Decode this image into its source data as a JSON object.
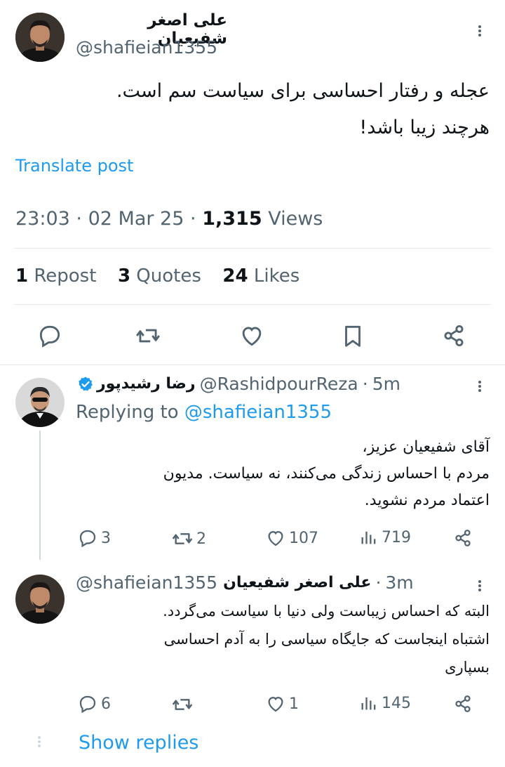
{
  "main_post": {
    "author_name": "علی اصغر شفیعیان",
    "handle": "@shafieian1355",
    "text_line1": "عجله و رفتار احساسی برای سیاست سم است.",
    "text_line2": "هرچند زیبا باشد!",
    "translate_label": "Translate post",
    "time": "23:03",
    "date": "02 Mar 25",
    "views_count": "1,315",
    "views_label": "Views",
    "separator": "·",
    "reposts_count": "1",
    "reposts_label": "Repost",
    "quotes_count": "3",
    "quotes_label": "Quotes",
    "likes_count": "24",
    "likes_label": "Likes",
    "icons": [
      "reply-icon",
      "repost-icon",
      "like-icon",
      "bookmark-icon",
      "share-icon"
    ]
  },
  "reply1": {
    "author_name": "رضا رشیدپور",
    "handle": "@RashidpourReza",
    "time": "5m",
    "replying_prefix": "Replying to",
    "replying_handle": "@shafieian1355",
    "line1": "آقای شفیعیان عزیز،",
    "line2": "مردم با احساس زندگی می‌کنند، نه سیاست. مدیون",
    "line3": "اعتماد مردم نشوید.",
    "replies": "3",
    "reposts": "2",
    "likes": "107",
    "views": "719"
  },
  "reply2": {
    "author_name": "علی اصغر شفیعیان",
    "handle": "@shafieian1355",
    "time": "3m",
    "line1": "البته که احساس زیباست ولی دنیا با سیاست می‌گردد.",
    "line2": "اشتباه اینجاست که جایگاه سیاسی را به آدم احساسی",
    "line3": "بسپاری",
    "replies": "6",
    "reposts": "",
    "likes": "1",
    "views": "145"
  },
  "show_replies_label": "Show replies",
  "colors": {
    "link": "#1d9bf0",
    "muted": "#536471",
    "text": "#0f1419",
    "verified": "#1d9bf0"
  }
}
